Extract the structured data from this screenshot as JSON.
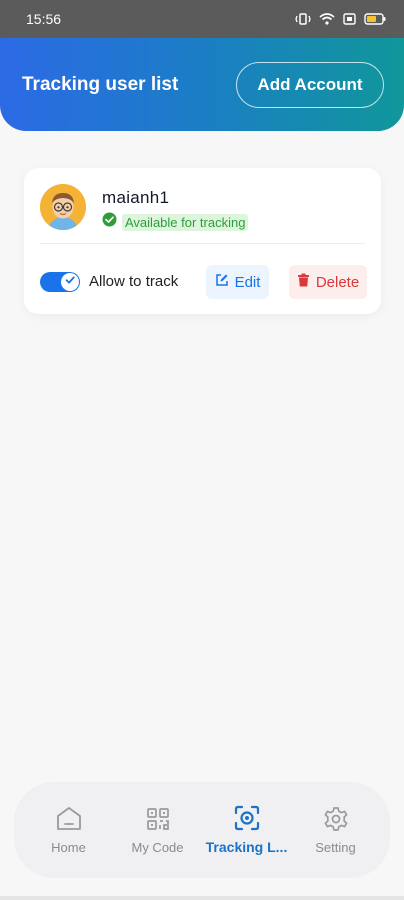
{
  "status_bar": {
    "time": "15:56"
  },
  "header": {
    "title": "Tracking user list",
    "add_account_label": "Add Account"
  },
  "accounts": [
    {
      "name": "maianh1",
      "status": "Available for tracking",
      "allow_label": "Allow to track",
      "allow_enabled": true,
      "edit_label": "Edit",
      "delete_label": "Delete"
    }
  ],
  "nav": {
    "items": [
      {
        "label": "Home",
        "icon": "home-icon"
      },
      {
        "label": "My Code",
        "icon": "qr-code-icon"
      },
      {
        "label": "Tracking L...",
        "icon": "scan-face-icon",
        "active": true
      },
      {
        "label": "Setting",
        "icon": "gear-icon"
      }
    ]
  },
  "colors": {
    "header_start": "#2c6ae6",
    "header_end": "#10979a",
    "accent": "#1a73e8",
    "status_green": "#2f9e3a",
    "delete_red": "#d83a3a"
  }
}
